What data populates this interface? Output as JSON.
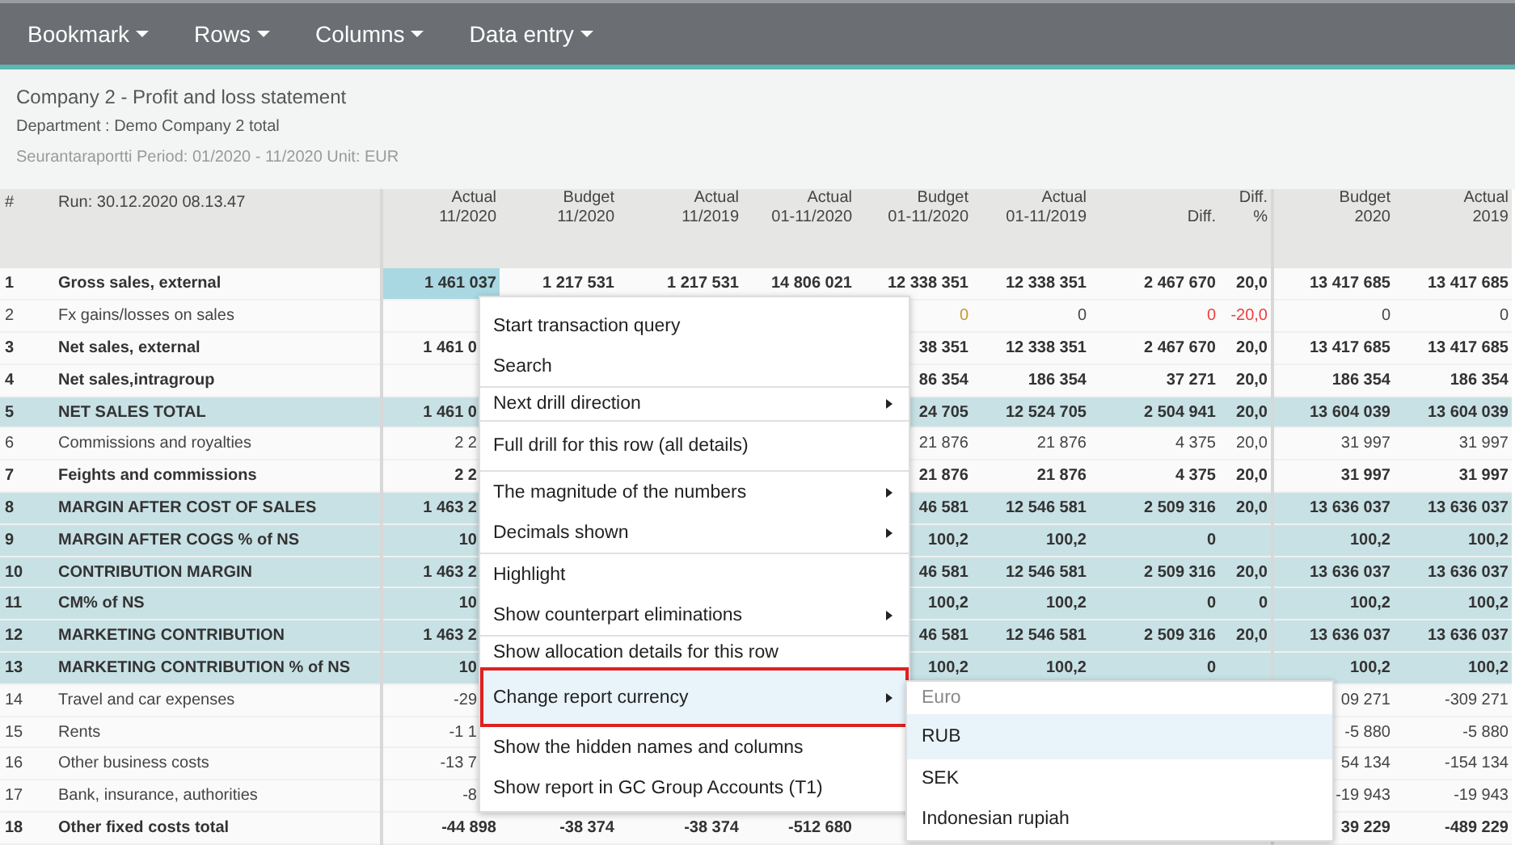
{
  "toolbar": {
    "menus": [
      {
        "label": "Bookmark"
      },
      {
        "label": "Rows"
      },
      {
        "label": "Columns"
      },
      {
        "label": "Data entry"
      }
    ]
  },
  "report": {
    "title": "Company 2 - Profit and loss statement",
    "department": "Department : Demo Company 2 total",
    "period": "Seurantaraportti Period: 01/2020 - 11/2020 Unit: EUR"
  },
  "table": {
    "number_heading": "#",
    "run_heading": "Run: 30.12.2020 08.13.47",
    "columns": [
      {
        "lines": [
          "Actual",
          "11/2020"
        ]
      },
      {
        "lines": [
          "Budget",
          "11/2020"
        ]
      },
      {
        "lines": [
          "Actual",
          "11/2019"
        ]
      },
      {
        "lines": [
          "Actual",
          "01-11/2020"
        ]
      },
      {
        "lines": [
          "Budget",
          "01-11/2020"
        ]
      },
      {
        "lines": [
          "Actual",
          "01-11/2019"
        ]
      },
      {
        "lines": [
          "Diff."
        ]
      },
      {
        "lines": [
          "Diff.",
          "%"
        ]
      },
      {
        "lines": [
          "Budget",
          "2020"
        ]
      },
      {
        "lines": [
          "Actual",
          "2019"
        ]
      }
    ],
    "rows": [
      {
        "number": "1",
        "label": "Gross sales, external",
        "kind": "subtotal",
        "selected": true,
        "cells": [
          "1 461 037",
          "1 217 531",
          "1 217 531",
          "14 806 021",
          "12 338 351",
          "12 338 351",
          "2 467 670",
          "20,0",
          "13 417 685",
          "13 417 685"
        ]
      },
      {
        "number": "2",
        "label": "Fx gains/losses on sales",
        "kind": "line",
        "selected": false,
        "cells": [
          null,
          null,
          null,
          null,
          {
            "text": "0",
            "color": "#c9962a"
          },
          "0",
          {
            "text": "0",
            "color": "#f03a3a"
          },
          {
            "text": "-20,0",
            "color": "#f03a3a"
          },
          "0",
          "0"
        ]
      },
      {
        "number": "3",
        "label": "Net sales, external",
        "kind": "subtotal",
        "selected": false,
        "cells": [
          {
            "text": "1 461 0",
            "cut": true
          },
          null,
          null,
          null,
          "38 351",
          "12 338 351",
          "2 467 670",
          "20,0",
          "13 417 685",
          "13 417 685"
        ]
      },
      {
        "number": "4",
        "label": "Net sales,intragroup",
        "kind": "subtotal",
        "selected": false,
        "cells": [
          null,
          null,
          null,
          null,
          "86 354",
          "186 354",
          "37 271",
          "20,0",
          "186 354",
          "186 354"
        ]
      },
      {
        "number": "5",
        "label": "NET SALES TOTAL",
        "kind": "total",
        "selected": false,
        "cells": [
          {
            "text": "1 461 0",
            "cut": true
          },
          null,
          null,
          null,
          "24 705",
          "12 524 705",
          "2 504 941",
          "20,0",
          "13 604 039",
          "13 604 039"
        ]
      },
      {
        "number": "6",
        "label": "Commissions and royalties",
        "kind": "line",
        "selected": false,
        "cells": [
          {
            "text": "2 2",
            "cut": true
          },
          null,
          null,
          null,
          "21 876",
          "21 876",
          "4 375",
          "20,0",
          "31 997",
          "31 997"
        ]
      },
      {
        "number": "7",
        "label": "Feights and commissions",
        "kind": "subtotal",
        "selected": false,
        "cells": [
          {
            "text": "2 2",
            "cut": true
          },
          null,
          null,
          null,
          "21 876",
          "21 876",
          "4 375",
          "20,0",
          "31 997",
          "31 997"
        ]
      },
      {
        "number": "8",
        "label": "MARGIN AFTER COST OF SALES",
        "kind": "total",
        "selected": false,
        "cells": [
          {
            "text": "1 463 2",
            "cut": true
          },
          null,
          null,
          null,
          "46 581",
          "12 546 581",
          "2 509 316",
          "20,0",
          "13 636 037",
          "13 636 037"
        ]
      },
      {
        "number": "9",
        "label": "MARGIN AFTER COGS % of NS",
        "kind": "total",
        "selected": false,
        "cells": [
          {
            "text": "10",
            "cut": true
          },
          null,
          null,
          null,
          "100,2",
          "100,2",
          "0",
          null,
          "100,2",
          "100,2"
        ]
      },
      {
        "number": "10",
        "label": "CONTRIBUTION MARGIN",
        "kind": "total",
        "selected": false,
        "cells": [
          {
            "text": "1 463 2",
            "cut": true
          },
          null,
          null,
          null,
          "46 581",
          "12 546 581",
          "2 509 316",
          "20,0",
          "13 636 037",
          "13 636 037"
        ]
      },
      {
        "number": "11",
        "label": "CM% of NS",
        "kind": "total",
        "selected": false,
        "cells": [
          {
            "text": "10",
            "cut": true
          },
          null,
          null,
          null,
          "100,2",
          "100,2",
          "0",
          "0",
          "100,2",
          "100,2"
        ]
      },
      {
        "number": "12",
        "label": "MARKETING CONTRIBUTION",
        "kind": "total",
        "selected": false,
        "cells": [
          {
            "text": "1 463 2",
            "cut": true
          },
          null,
          null,
          null,
          "46 581",
          "12 546 581",
          "2 509 316",
          "20,0",
          "13 636 037",
          "13 636 037"
        ]
      },
      {
        "number": "13",
        "label": "MARKETING CONTRIBUTION % of NS",
        "kind": "total",
        "selected": false,
        "cells": [
          {
            "text": "10",
            "cut": true
          },
          null,
          null,
          null,
          "100,2",
          "100,2",
          "0",
          null,
          "100,2",
          "100,2"
        ]
      },
      {
        "number": "14",
        "label": "Travel and car expenses",
        "kind": "line",
        "selected": false,
        "cells": [
          {
            "text": "-29",
            "cut": true
          },
          null,
          null,
          null,
          null,
          null,
          null,
          null,
          "09 271",
          "-309 271"
        ]
      },
      {
        "number": "15",
        "label": "Rents",
        "kind": "line",
        "selected": false,
        "cells": [
          {
            "text": "-1 1",
            "cut": true
          },
          null,
          null,
          null,
          null,
          null,
          null,
          null,
          "-5 880",
          "-5 880"
        ]
      },
      {
        "number": "16",
        "label": "Other business costs",
        "kind": "line",
        "selected": false,
        "cells": [
          {
            "text": "-13 7",
            "cut": true
          },
          null,
          null,
          null,
          null,
          null,
          null,
          null,
          "54 134",
          "-154 134"
        ]
      },
      {
        "number": "17",
        "label": "Bank, insurance, authorities",
        "kind": "line",
        "selected": false,
        "cells": [
          {
            "text": "-8",
            "cut": true
          },
          null,
          null,
          null,
          null,
          null,
          null,
          null,
          "-19 943",
          "-19 943"
        ]
      },
      {
        "number": "18",
        "label": "Other fixed costs total",
        "kind": "subtotal",
        "selected": false,
        "cells": [
          "-44 898",
          "-38 374",
          "-38 374",
          "-512 680",
          null,
          null,
          null,
          null,
          "39 229",
          "-489 229"
        ]
      }
    ]
  },
  "context_menu": {
    "groups": [
      {
        "items": [
          {
            "label": "Start transaction query",
            "submenu": false,
            "selected": false
          },
          {
            "label": "Search",
            "submenu": false,
            "selected": false
          }
        ]
      },
      {
        "items": [
          {
            "label": "Next drill direction",
            "submenu": true,
            "selected": false
          }
        ]
      },
      {
        "items": [
          {
            "label": "Full drill for this row (all details)",
            "submenu": false,
            "selected": false
          }
        ]
      },
      {
        "items": [
          {
            "label": "The magnitude of the numbers",
            "submenu": true,
            "selected": false
          },
          {
            "label": "Decimals shown",
            "submenu": true,
            "selected": false
          }
        ]
      },
      {
        "items": [
          {
            "label": "Highlight",
            "submenu": false,
            "selected": false
          },
          {
            "label": "Show counterpart eliminations",
            "submenu": true,
            "selected": false
          }
        ]
      },
      {
        "items": [
          {
            "label": "Show allocation details for this row",
            "submenu": false,
            "selected": false
          },
          {
            "label": "Change report currency",
            "submenu": true,
            "selected": true
          },
          {
            "label": "Show the hidden names and columns",
            "submenu": false,
            "selected": false
          },
          {
            "label": "Show report in GC Group Accounts (T1)",
            "submenu": false,
            "selected": false
          }
        ]
      }
    ]
  },
  "currency_submenu": {
    "items": [
      {
        "label": "Euro",
        "disabled": true,
        "selected": false
      },
      {
        "label": "RUB",
        "disabled": false,
        "selected": true
      },
      {
        "label": "SEK",
        "disabled": false,
        "selected": false
      },
      {
        "label": "Indonesian rupiah",
        "disabled": false,
        "selected": false
      }
    ]
  }
}
